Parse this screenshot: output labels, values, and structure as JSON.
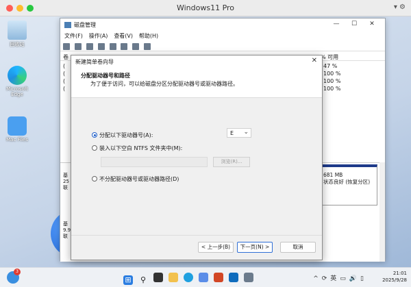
{
  "host": {
    "title": "Windows11 Pro"
  },
  "desktop": {
    "icons": [
      {
        "label": "回收站"
      },
      {
        "label": "Microsoft Edge"
      },
      {
        "label": "Mac Files"
      }
    ]
  },
  "disk_mgmt": {
    "title": "磁盘管理",
    "menu": [
      "文件(F)",
      "操作(A)",
      "查看(V)",
      "帮助(H)"
    ],
    "col_left": "卷",
    "col_right": "% 可用",
    "rows": [
      {
        "mark": "(",
        "pct": "47 %"
      },
      {
        "mark": "(",
        "pct": "100 %"
      },
      {
        "mark": "(",
        "pct": "100 %"
      },
      {
        "mark": "(",
        "pct": "100 %"
      }
    ],
    "disk_rows": [
      {
        "lines": [
          "基",
          "25",
          "联"
        ]
      },
      {
        "lines": [
          "基",
          "9.9",
          "联"
        ]
      }
    ],
    "vol": {
      "size": "681 MB",
      "status": "状态良好 (恢复分区)"
    }
  },
  "wizard": {
    "title": "新建简单卷向导",
    "heading": "分配驱动器号和路径",
    "subheading": "为了便于访问，可以给磁盘分区分配驱动器号或驱动器路径。",
    "opt_assign": "分配以下驱动器号(A):",
    "drive_letter": "E",
    "opt_mount": "装入以下空白 NTFS 文件夹中(M):",
    "browse_label": "浏览(R)...",
    "opt_none": "不分配驱动器号或驱动器路径(D)",
    "back_label": "< 上一步(B)",
    "next_label": "下一页(N) >",
    "cancel_label": "取消"
  },
  "taskbar": {
    "badge": "3",
    "tray": {
      "ime": "英"
    },
    "time": "21:01",
    "date": "2025/9/28"
  }
}
